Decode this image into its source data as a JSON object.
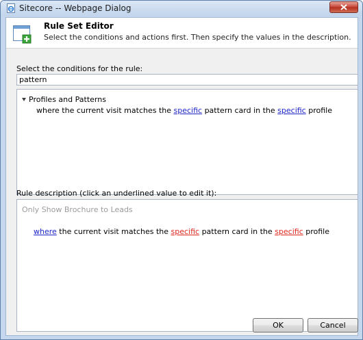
{
  "window": {
    "title": "Sitecore -- Webpage Dialog"
  },
  "header": {
    "title": "Rule Set Editor",
    "subtitle": "Select the conditions and actions first. Then specify the values in the description."
  },
  "conditions": {
    "label": "Select the conditions for the rule:",
    "search_value": "pattern",
    "group_label": "Profiles and Patterns",
    "condition": {
      "part1": "where the current visit matches the ",
      "link1": "specific",
      "part2": " pattern card in the ",
      "link2": "specific",
      "part3": " profile"
    }
  },
  "description": {
    "label": "Rule description (click an underlined value to edit it):",
    "rule_name": "Only Show Brochure to Leads",
    "rule": {
      "link0": "where",
      "part1": " the current visit matches the ",
      "link1": "specific",
      "part2": " pattern card in the ",
      "link2": "specific",
      "part3": " profile"
    }
  },
  "buttons": {
    "ok": "OK",
    "cancel": "Cancel"
  },
  "colors": {
    "link_blue": "#1d26c9",
    "link_red": "#e0281e",
    "titlebar": "#c5d7ec",
    "close": "#c7463a"
  },
  "icons": {
    "app": "ie-page-icon",
    "close": "close-icon",
    "header": "rule-set-editor-icon",
    "tree": "expand-arrow-icon"
  }
}
